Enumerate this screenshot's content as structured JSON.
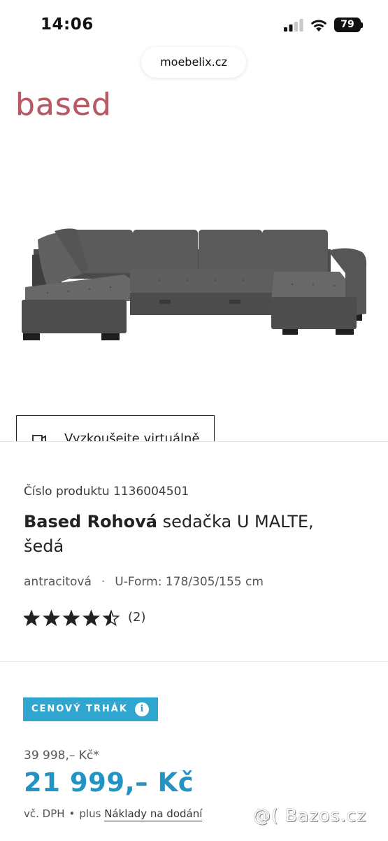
{
  "status_bar": {
    "time": "14:06",
    "battery": "79"
  },
  "browser": {
    "url": "moebelix.cz"
  },
  "brand": {
    "logo_text": "based",
    "logo_color": "#b85a66"
  },
  "ar_button": {
    "label": "Vyzkoušejte virtuálně",
    "icon": "ar-cube-icon"
  },
  "product": {
    "number_label": "Číslo produktu 1136004501",
    "title_bold": "Based Rohová",
    "title_rest": " sedačka U MALTE, šedá",
    "color": "antracitová",
    "dimensions": "U-Form: 178/305/155 cm",
    "rating": 4.5,
    "rating_max": 5,
    "review_count": "(2)"
  },
  "pricing": {
    "badge_label": "CENOVÝ TRHÁK",
    "badge_info": "i",
    "badge_color": "#2fa6cf",
    "old_price": "39 998,– Kč*",
    "new_price": "21 999,– Kč",
    "price_color": "#2393c4",
    "vat_text": "vč. DPH",
    "shipping_prefix": "plus",
    "shipping_link": "Náklady na dodání"
  },
  "watermark": "@( Bazos.cz"
}
